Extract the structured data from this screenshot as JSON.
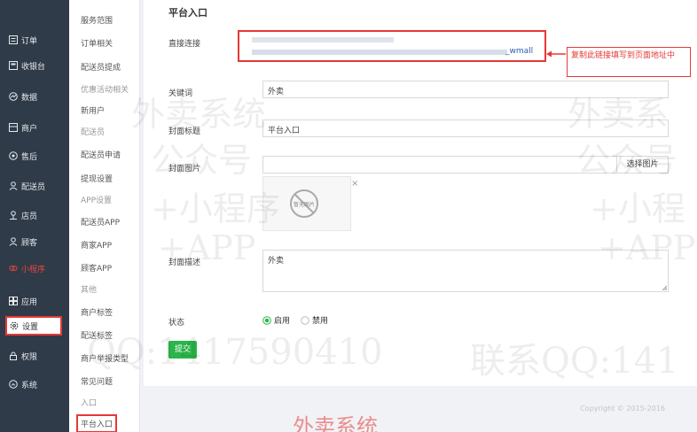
{
  "sidebar": {
    "items": [
      {
        "label": "订单",
        "icon": "list-icon"
      },
      {
        "label": "收银台",
        "icon": "register-icon"
      },
      {
        "label": "数据",
        "icon": "chart-icon"
      },
      {
        "label": "商户",
        "icon": "shop-icon"
      },
      {
        "label": "售后",
        "icon": "service-icon"
      },
      {
        "label": "配送员",
        "icon": "courier-icon"
      },
      {
        "label": "店员",
        "icon": "clerk-icon"
      },
      {
        "label": "顾客",
        "icon": "customer-icon"
      },
      {
        "label": "小程序",
        "icon": "miniprogram-icon"
      },
      {
        "label": "应用",
        "icon": "apps-icon"
      },
      {
        "label": "设置",
        "icon": "gear-icon"
      },
      {
        "label": "权限",
        "icon": "lock-icon"
      },
      {
        "label": "系统",
        "icon": "system-icon"
      }
    ]
  },
  "submenu": {
    "items": [
      {
        "label": "服务范围"
      },
      {
        "label": "订单相关"
      },
      {
        "label": "配送员提成"
      },
      {
        "label": "优惠活动相关"
      },
      {
        "label": "新用户"
      },
      {
        "label": "配送员"
      },
      {
        "label": "配送员申请"
      },
      {
        "label": "提现设置"
      },
      {
        "label": "APP设置"
      },
      {
        "label": "配送员APP"
      },
      {
        "label": "商家APP"
      },
      {
        "label": "顾客APP"
      },
      {
        "label": "其他"
      },
      {
        "label": "商户标签"
      },
      {
        "label": "配送标签"
      },
      {
        "label": "商户举报类型"
      },
      {
        "label": "常见问题"
      },
      {
        "label": "入口"
      },
      {
        "label": "平台入口"
      }
    ]
  },
  "page": {
    "title": "平台入口",
    "direct_link_label": "直接连接",
    "direct_link_suffix": "_wmall",
    "annotation_text": "复制此链接填写到页面地址中",
    "keyword_label": "关键词",
    "keyword_value": "外卖",
    "cover_title_label": "封面标题",
    "cover_title_value": "平台入口",
    "cover_image_label": "封面图片",
    "select_image_label": "选择图片",
    "no_image_text": "暂无图片",
    "remove_image_symbol": "×",
    "cover_desc_label": "封面描述",
    "cover_desc_value": "外卖",
    "status_label": "状态",
    "status_options": [
      {
        "label": "启用",
        "checked": true
      },
      {
        "label": "禁用",
        "checked": false
      }
    ],
    "submit_label": "提交",
    "copyright": "Copyright © 2015-2016"
  },
  "watermark": {
    "lines": [
      "外卖系统",
      "公众号",
      "+小程序",
      "+APP",
      "外卖系",
      "公众号",
      "+小程",
      "+APP",
      "QQ:1417590410",
      "联系QQ:141",
      "外卖系统"
    ]
  },
  "colors": {
    "sidebar_bg": "#2f3b48",
    "accent_green": "#2bb54a",
    "annotation_red": "#e53935"
  }
}
